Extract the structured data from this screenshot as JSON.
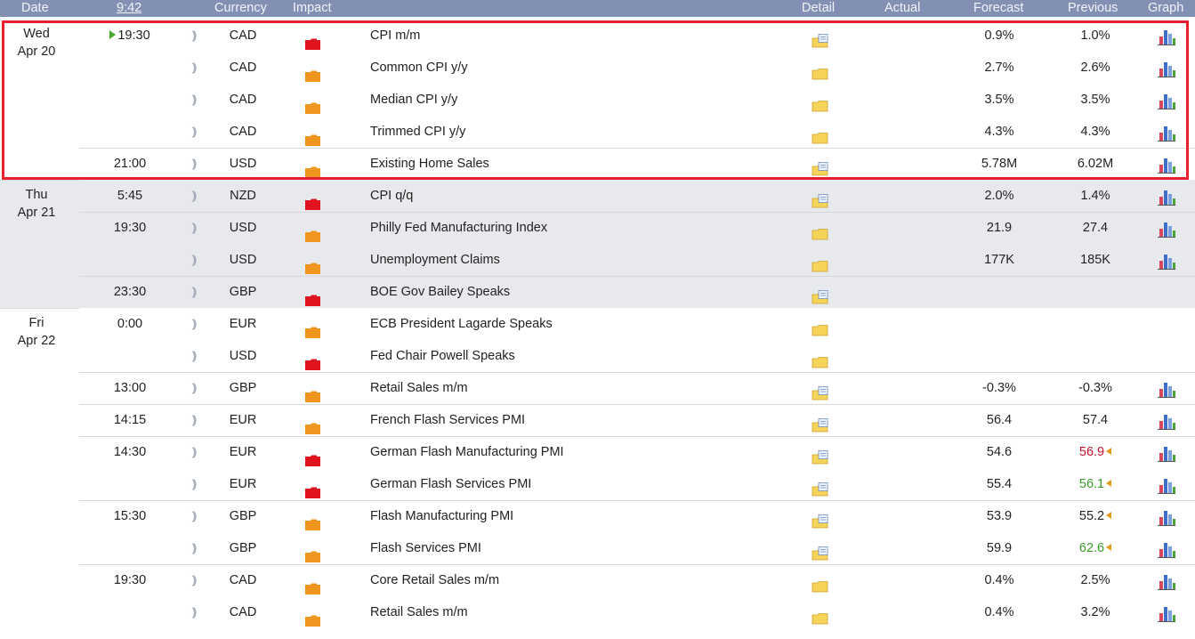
{
  "header": {
    "date": "Date",
    "time": "9:42",
    "currency": "Currency",
    "impact": "Impact",
    "detail": "Detail",
    "actual": "Actual",
    "forecast": "Forecast",
    "previous": "Previous",
    "graph": "Graph"
  },
  "days": [
    {
      "day": "Wed",
      "date": "Apr 20",
      "grey": false,
      "rows": 5
    },
    {
      "day": "Thu",
      "date": "Apr 21",
      "grey": true,
      "rows": 4
    },
    {
      "day": "Fri",
      "date": "Apr 22",
      "grey": false,
      "rows": 10
    }
  ],
  "rows": [
    {
      "time": "19:30",
      "current": true,
      "currency": "CAD",
      "impact": "high",
      "event": "CPI m/m",
      "detail": "updated",
      "forecast": "0.9%",
      "previous": "1.0%",
      "graph": true,
      "first": true
    },
    {
      "time": "",
      "currency": "CAD",
      "impact": "medium",
      "event": "Common CPI y/y",
      "detail": "folder",
      "forecast": "2.7%",
      "previous": "2.6%",
      "graph": true
    },
    {
      "time": "",
      "currency": "CAD",
      "impact": "medium",
      "event": "Median CPI y/y",
      "detail": "folder",
      "forecast": "3.5%",
      "previous": "3.5%",
      "graph": true
    },
    {
      "time": "",
      "currency": "CAD",
      "impact": "medium",
      "event": "Trimmed CPI y/y",
      "detail": "folder",
      "forecast": "4.3%",
      "previous": "4.3%",
      "graph": true
    },
    {
      "time": "21:00",
      "currency": "USD",
      "impact": "medium",
      "event": "Existing Home Sales",
      "detail": "updated",
      "forecast": "5.78M",
      "previous": "6.02M",
      "graph": true,
      "first": true
    },
    {
      "time": "5:45",
      "currency": "NZD",
      "impact": "high",
      "event": "CPI q/q",
      "detail": "updated",
      "forecast": "2.0%",
      "previous": "1.4%",
      "graph": true,
      "first": true
    },
    {
      "time": "19:30",
      "currency": "USD",
      "impact": "medium",
      "event": "Philly Fed Manufacturing Index",
      "detail": "folder",
      "forecast": "21.9",
      "previous": "27.4",
      "graph": true,
      "first": true
    },
    {
      "time": "",
      "currency": "USD",
      "impact": "medium",
      "event": "Unemployment Claims",
      "detail": "folder",
      "forecast": "177K",
      "previous": "185K",
      "graph": true
    },
    {
      "time": "23:30",
      "currency": "GBP",
      "impact": "high",
      "event": "BOE Gov Bailey Speaks",
      "detail": "updated",
      "forecast": "",
      "previous": "",
      "graph": false,
      "first": true
    },
    {
      "time": "0:00",
      "currency": "EUR",
      "impact": "medium",
      "event": "ECB President Lagarde Speaks",
      "detail": "folder",
      "forecast": "",
      "previous": "",
      "graph": false,
      "first": true
    },
    {
      "time": "",
      "currency": "USD",
      "impact": "high",
      "event": "Fed Chair Powell Speaks",
      "detail": "folder",
      "forecast": "",
      "previous": "",
      "graph": false
    },
    {
      "time": "13:00",
      "currency": "GBP",
      "impact": "medium",
      "event": "Retail Sales m/m",
      "detail": "updated",
      "forecast": "-0.3%",
      "previous": "-0.3%",
      "graph": true,
      "first": true
    },
    {
      "time": "14:15",
      "currency": "EUR",
      "impact": "medium",
      "event": "French Flash Services PMI",
      "detail": "updated",
      "forecast": "56.4",
      "previous": "57.4",
      "graph": true,
      "first": true
    },
    {
      "time": "14:30",
      "currency": "EUR",
      "impact": "high",
      "event": "German Flash Manufacturing PMI",
      "detail": "updated",
      "forecast": "54.6",
      "previous": "56.9",
      "prev_color": "red",
      "revised": true,
      "graph": true,
      "first": true
    },
    {
      "time": "",
      "currency": "EUR",
      "impact": "high",
      "event": "German Flash Services PMI",
      "detail": "updated",
      "forecast": "55.4",
      "previous": "56.1",
      "prev_color": "green",
      "revised": true,
      "graph": true
    },
    {
      "time": "15:30",
      "currency": "GBP",
      "impact": "medium",
      "event": "Flash Manufacturing PMI",
      "detail": "updated",
      "forecast": "53.9",
      "previous": "55.2",
      "revised": true,
      "graph": true,
      "first": true
    },
    {
      "time": "",
      "currency": "GBP",
      "impact": "medium",
      "event": "Flash Services PMI",
      "detail": "updated",
      "forecast": "59.9",
      "previous": "62.6",
      "prev_color": "green",
      "revised": true,
      "graph": true
    },
    {
      "time": "19:30",
      "currency": "CAD",
      "impact": "medium",
      "event": "Core Retail Sales m/m",
      "detail": "folder",
      "forecast": "0.4%",
      "previous": "2.5%",
      "graph": true,
      "first": true
    },
    {
      "time": "",
      "currency": "CAD",
      "impact": "medium",
      "event": "Retail Sales m/m",
      "detail": "folder",
      "forecast": "0.4%",
      "previous": "3.2%",
      "graph": true
    }
  ],
  "colors": {
    "header_bg": "#8190b3",
    "impact_high": "#e0141e",
    "impact_medium": "#f0961e",
    "highlight": "#e8202e"
  },
  "icons": {
    "sound": "sound-icon",
    "impact": "impact-folder-icon",
    "detail": "detail-folder-icon",
    "graph": "graph-icon",
    "current": "current-play-icon",
    "revised": "revised-arrow-icon"
  }
}
